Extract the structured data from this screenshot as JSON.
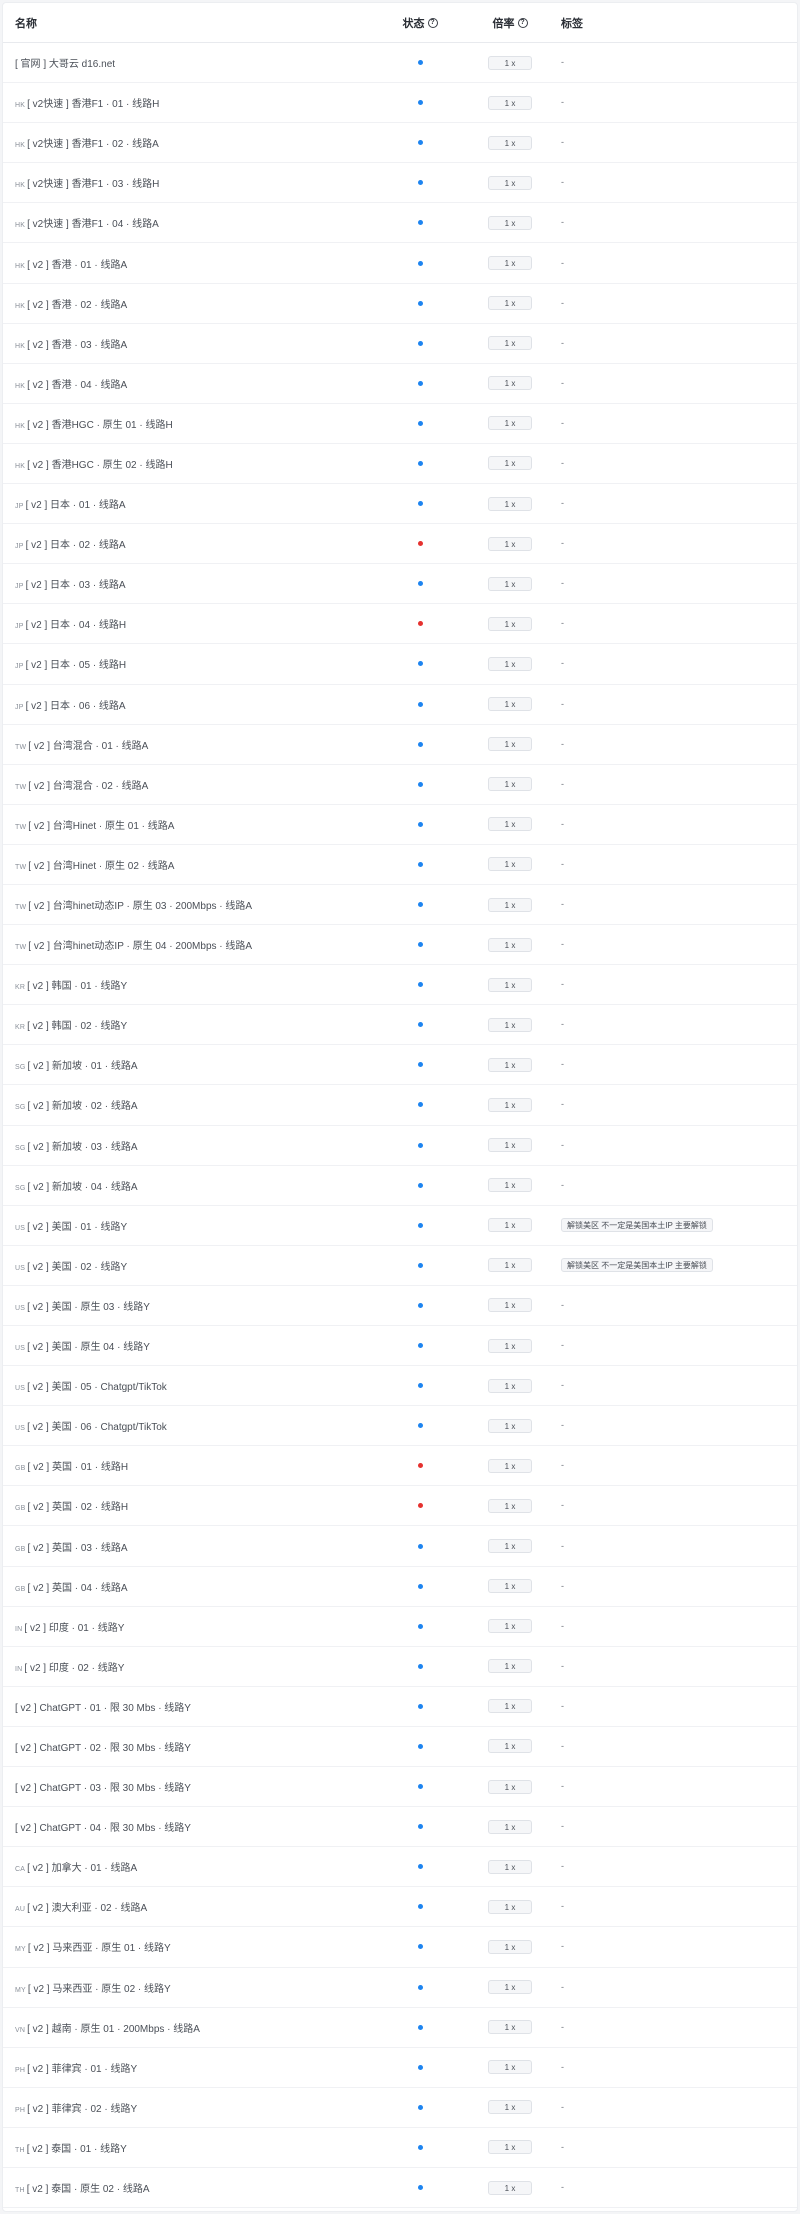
{
  "columns": {
    "name": "名称",
    "status": "状态",
    "rate": "倍率",
    "tags": "标签"
  },
  "colors": {
    "online": "#1d84f0",
    "offline": "#e5312f"
  },
  "rows": [
    {
      "cc": "",
      "name": "[ 官网 ] 大哥云 d16.net",
      "status": "online",
      "rate": "1 x",
      "tag": ""
    },
    {
      "cc": "HK",
      "name": "[ v2快速 ] 香港F1 · 01 · 线路H",
      "status": "online",
      "rate": "1 x",
      "tag": ""
    },
    {
      "cc": "HK",
      "name": "[ v2快速 ] 香港F1 · 02 · 线路A",
      "status": "online",
      "rate": "1 x",
      "tag": ""
    },
    {
      "cc": "HK",
      "name": "[ v2快速 ] 香港F1 · 03 · 线路H",
      "status": "online",
      "rate": "1 x",
      "tag": ""
    },
    {
      "cc": "HK",
      "name": "[ v2快速 ] 香港F1 · 04 · 线路A",
      "status": "online",
      "rate": "1 x",
      "tag": ""
    },
    {
      "cc": "HK",
      "name": "[ v2 ] 香港 · 01 · 线路A",
      "status": "online",
      "rate": "1 x",
      "tag": ""
    },
    {
      "cc": "HK",
      "name": "[ v2 ] 香港 · 02 · 线路A",
      "status": "online",
      "rate": "1 x",
      "tag": ""
    },
    {
      "cc": "HK",
      "name": "[ v2 ] 香港 · 03 · 线路A",
      "status": "online",
      "rate": "1 x",
      "tag": ""
    },
    {
      "cc": "HK",
      "name": "[ v2 ] 香港 · 04 · 线路A",
      "status": "online",
      "rate": "1 x",
      "tag": ""
    },
    {
      "cc": "HK",
      "name": "[ v2 ] 香港HGC · 原生 01 · 线路H",
      "status": "online",
      "rate": "1 x",
      "tag": ""
    },
    {
      "cc": "HK",
      "name": "[ v2 ] 香港HGC · 原生 02 · 线路H",
      "status": "online",
      "rate": "1 x",
      "tag": ""
    },
    {
      "cc": "JP",
      "name": "[ v2 ] 日本 · 01 · 线路A",
      "status": "online",
      "rate": "1 x",
      "tag": ""
    },
    {
      "cc": "JP",
      "name": "[ v2 ] 日本 · 02 · 线路A",
      "status": "offline",
      "rate": "1 x",
      "tag": ""
    },
    {
      "cc": "JP",
      "name": "[ v2 ] 日本 · 03 · 线路A",
      "status": "online",
      "rate": "1 x",
      "tag": ""
    },
    {
      "cc": "JP",
      "name": "[ v2 ] 日本 · 04 · 线路H",
      "status": "offline",
      "rate": "1 x",
      "tag": ""
    },
    {
      "cc": "JP",
      "name": "[ v2 ] 日本 · 05 · 线路H",
      "status": "online",
      "rate": "1 x",
      "tag": ""
    },
    {
      "cc": "JP",
      "name": "[ v2 ] 日本 · 06 · 线路A",
      "status": "online",
      "rate": "1 x",
      "tag": ""
    },
    {
      "cc": "TW",
      "name": "[ v2 ] 台湾混合 · 01 · 线路A",
      "status": "online",
      "rate": "1 x",
      "tag": ""
    },
    {
      "cc": "TW",
      "name": "[ v2 ] 台湾混合 · 02 · 线路A",
      "status": "online",
      "rate": "1 x",
      "tag": ""
    },
    {
      "cc": "TW",
      "name": "[ v2 ] 台湾Hinet · 原生 01 · 线路A",
      "status": "online",
      "rate": "1 x",
      "tag": ""
    },
    {
      "cc": "TW",
      "name": "[ v2 ] 台湾Hinet · 原生 02 · 线路A",
      "status": "online",
      "rate": "1 x",
      "tag": ""
    },
    {
      "cc": "TW",
      "name": "[ v2 ] 台湾hinet动态IP · 原生 03 · 200Mbps · 线路A",
      "status": "online",
      "rate": "1 x",
      "tag": ""
    },
    {
      "cc": "TW",
      "name": "[ v2 ] 台湾hinet动态IP · 原生 04 · 200Mbps · 线路A",
      "status": "online",
      "rate": "1 x",
      "tag": ""
    },
    {
      "cc": "KR",
      "name": "[ v2 ] 韩国 · 01 · 线路Y",
      "status": "online",
      "rate": "1 x",
      "tag": ""
    },
    {
      "cc": "KR",
      "name": "[ v2 ] 韩国 · 02 · 线路Y",
      "status": "online",
      "rate": "1 x",
      "tag": ""
    },
    {
      "cc": "SG",
      "name": "[ v2 ] 新加坡 · 01 · 线路A",
      "status": "online",
      "rate": "1 x",
      "tag": ""
    },
    {
      "cc": "SG",
      "name": "[ v2 ] 新加坡 · 02 · 线路A",
      "status": "online",
      "rate": "1 x",
      "tag": ""
    },
    {
      "cc": "SG",
      "name": "[ v2 ] 新加坡 · 03 · 线路A",
      "status": "online",
      "rate": "1 x",
      "tag": ""
    },
    {
      "cc": "SG",
      "name": "[ v2 ] 新加坡 · 04 · 线路A",
      "status": "online",
      "rate": "1 x",
      "tag": ""
    },
    {
      "cc": "US",
      "name": "[ v2 ] 美国 · 01 · 线路Y",
      "status": "online",
      "rate": "1 x",
      "tag": "解锁美区 不一定是美国本土IP 主要解锁"
    },
    {
      "cc": "US",
      "name": "[ v2 ] 美国 · 02 · 线路Y",
      "status": "online",
      "rate": "1 x",
      "tag": "解锁美区 不一定是美国本土IP 主要解锁"
    },
    {
      "cc": "US",
      "name": "[ v2 ] 美国 · 原生 03 · 线路Y",
      "status": "online",
      "rate": "1 x",
      "tag": ""
    },
    {
      "cc": "US",
      "name": "[ v2 ] 美国 · 原生 04 · 线路Y",
      "status": "online",
      "rate": "1 x",
      "tag": ""
    },
    {
      "cc": "US",
      "name": "[ v2 ] 美国 · 05 · Chatgpt/TikTok",
      "status": "online",
      "rate": "1 x",
      "tag": ""
    },
    {
      "cc": "US",
      "name": "[ v2 ] 美国 · 06 · Chatgpt/TikTok",
      "status": "online",
      "rate": "1 x",
      "tag": ""
    },
    {
      "cc": "GB",
      "name": "[ v2 ] 英国 · 01 · 线路H",
      "status": "offline",
      "rate": "1 x",
      "tag": ""
    },
    {
      "cc": "GB",
      "name": "[ v2 ] 英国 · 02 · 线路H",
      "status": "offline",
      "rate": "1 x",
      "tag": ""
    },
    {
      "cc": "GB",
      "name": "[ v2 ] 英国 · 03 · 线路A",
      "status": "online",
      "rate": "1 x",
      "tag": ""
    },
    {
      "cc": "GB",
      "name": "[ v2 ] 英国 · 04 · 线路A",
      "status": "online",
      "rate": "1 x",
      "tag": ""
    },
    {
      "cc": "IN",
      "name": "[ v2 ] 印度 · 01 · 线路Y",
      "status": "online",
      "rate": "1 x",
      "tag": ""
    },
    {
      "cc": "IN",
      "name": "[ v2 ] 印度 · 02 · 线路Y",
      "status": "online",
      "rate": "1 x",
      "tag": ""
    },
    {
      "cc": "",
      "name": "[ v2 ] ChatGPT · 01 · 限 30 Mbs · 线路Y",
      "status": "online",
      "rate": "1 x",
      "tag": ""
    },
    {
      "cc": "",
      "name": "[ v2 ] ChatGPT · 02 · 限 30 Mbs · 线路Y",
      "status": "online",
      "rate": "1 x",
      "tag": ""
    },
    {
      "cc": "",
      "name": "[ v2 ] ChatGPT · 03 · 限 30 Mbs · 线路Y",
      "status": "online",
      "rate": "1 x",
      "tag": ""
    },
    {
      "cc": "",
      "name": "[ v2 ] ChatGPT · 04 · 限 30 Mbs · 线路Y",
      "status": "online",
      "rate": "1 x",
      "tag": ""
    },
    {
      "cc": "CA",
      "name": "[ v2 ] 加拿大 · 01 · 线路A",
      "status": "online",
      "rate": "1 x",
      "tag": ""
    },
    {
      "cc": "AU",
      "name": "[ v2 ] 澳大利亚 · 02 · 线路A",
      "status": "online",
      "rate": "1 x",
      "tag": ""
    },
    {
      "cc": "MY",
      "name": "[ v2 ] 马来西亚 · 原生 01 · 线路Y",
      "status": "online",
      "rate": "1 x",
      "tag": ""
    },
    {
      "cc": "MY",
      "name": "[ v2 ] 马来西亚 · 原生 02 · 线路Y",
      "status": "online",
      "rate": "1 x",
      "tag": ""
    },
    {
      "cc": "VN",
      "name": "[ v2 ] 越南 · 原生 01 · 200Mbps · 线路A",
      "status": "online",
      "rate": "1 x",
      "tag": ""
    },
    {
      "cc": "PH",
      "name": "[ v2 ] 菲律宾 · 01 · 线路Y",
      "status": "online",
      "rate": "1 x",
      "tag": ""
    },
    {
      "cc": "PH",
      "name": "[ v2 ] 菲律宾 · 02 · 线路Y",
      "status": "online",
      "rate": "1 x",
      "tag": ""
    },
    {
      "cc": "TH",
      "name": "[ v2 ] 泰国 · 01 · 线路Y",
      "status": "online",
      "rate": "1 x",
      "tag": ""
    },
    {
      "cc": "TH",
      "name": "[ v2 ] 泰国 · 原生 02 · 线路A",
      "status": "online",
      "rate": "1 x",
      "tag": ""
    }
  ],
  "empty_tag": "-"
}
